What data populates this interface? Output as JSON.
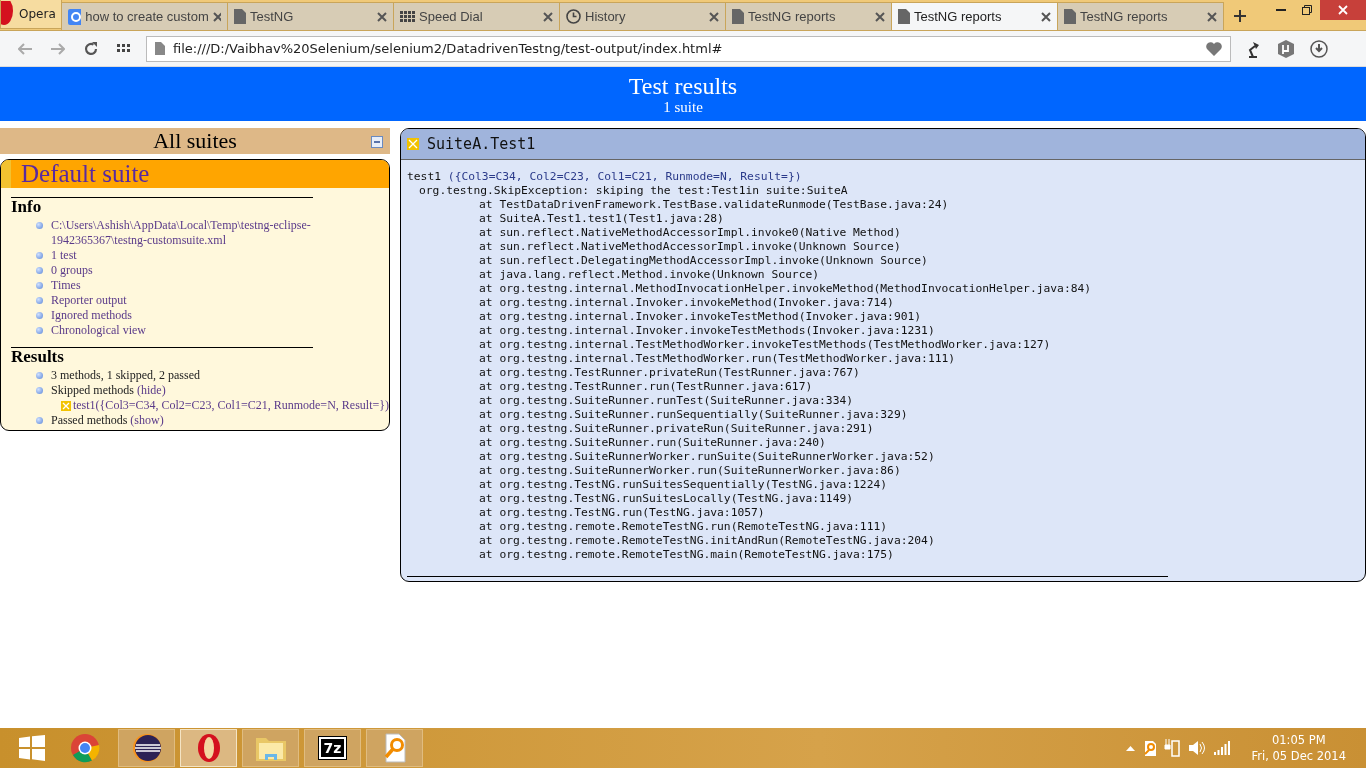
{
  "browser": {
    "menu_label": "Opera",
    "tabs": [
      {
        "kind": "google",
        "label": "how to create custom",
        "selected": false
      },
      {
        "kind": "page",
        "label": "TestNG",
        "selected": false
      },
      {
        "kind": "speeddial",
        "label": "Speed Dial",
        "selected": false
      },
      {
        "kind": "history",
        "label": "History",
        "selected": false
      },
      {
        "kind": "page",
        "label": "TestNG reports",
        "selected": false
      },
      {
        "kind": "page",
        "label": "TestNG reports",
        "selected": true
      },
      {
        "kind": "page",
        "label": "TestNG reports",
        "selected": false
      }
    ],
    "address": "file:///D:/Vaibhav%20Selenium/selenium2/DatadrivenTestng/test-output/index.html#"
  },
  "header": {
    "title": "Test results",
    "subtitle": "1 suite"
  },
  "sidebar": {
    "title": "All suites",
    "suite": {
      "name": "Default suite",
      "sections": [
        {
          "title": "Info",
          "items": [
            {
              "kind": "link",
              "text": "C:\\Users\\Ashish\\AppData\\Local\\Temp\\testng-eclipse-1942365367\\testng-customsuite.xml"
            },
            {
              "kind": "link",
              "text": "1 test"
            },
            {
              "kind": "link",
              "text": "0 groups"
            },
            {
              "kind": "link",
              "text": "Times"
            },
            {
              "kind": "link",
              "text": "Reporter output"
            },
            {
              "kind": "link",
              "text": "Ignored methods"
            },
            {
              "kind": "link",
              "text": "Chronological view"
            }
          ]
        },
        {
          "title": "Results",
          "items": [
            {
              "kind": "text",
              "text": "3 methods, 1 skipped, 2 passed"
            },
            {
              "kind": "text",
              "text": "Skipped methods",
              "link": "(hide)",
              "children": [
                {
                  "kind": "skipped",
                  "text": "test1({Col3=C34, Col2=C23, Col1=C21, Runmode=N, Result=})"
                }
              ]
            },
            {
              "kind": "text",
              "text": "Passed methods",
              "link": "(show)"
            }
          ]
        }
      ]
    }
  },
  "detail": {
    "title": "SuiteA.Test1",
    "method": "test1",
    "params": "({Col3=C34, Col2=C23, Col1=C21, Runmode=N, Result=})",
    "trace": [
      {
        "kind": "exception",
        "text": "org.testng.SkipException: skiping the test:Test1in suite:SuiteA"
      },
      {
        "kind": "frame",
        "text": "at TestDataDrivenFramework.TestBase.validateRunmode(TestBase.java:24)"
      },
      {
        "kind": "frame",
        "text": "at SuiteA.Test1.test1(Test1.java:28)"
      },
      {
        "kind": "frame",
        "text": "at sun.reflect.NativeMethodAccessorImpl.invoke0(Native Method)"
      },
      {
        "kind": "frame",
        "text": "at sun.reflect.NativeMethodAccessorImpl.invoke(Unknown Source)"
      },
      {
        "kind": "frame",
        "text": "at sun.reflect.DelegatingMethodAccessorImpl.invoke(Unknown Source)"
      },
      {
        "kind": "frame",
        "text": "at java.lang.reflect.Method.invoke(Unknown Source)"
      },
      {
        "kind": "frame",
        "text": "at org.testng.internal.MethodInvocationHelper.invokeMethod(MethodInvocationHelper.java:84)"
      },
      {
        "kind": "frame",
        "text": "at org.testng.internal.Invoker.invokeMethod(Invoker.java:714)"
      },
      {
        "kind": "frame",
        "text": "at org.testng.internal.Invoker.invokeTestMethod(Invoker.java:901)"
      },
      {
        "kind": "frame",
        "text": "at org.testng.internal.Invoker.invokeTestMethods(Invoker.java:1231)"
      },
      {
        "kind": "frame",
        "text": "at org.testng.internal.TestMethodWorker.invokeTestMethods(TestMethodWorker.java:127)"
      },
      {
        "kind": "frame",
        "text": "at org.testng.internal.TestMethodWorker.run(TestMethodWorker.java:111)"
      },
      {
        "kind": "frame",
        "text": "at org.testng.TestRunner.privateRun(TestRunner.java:767)"
      },
      {
        "kind": "frame",
        "text": "at org.testng.TestRunner.run(TestRunner.java:617)"
      },
      {
        "kind": "frame",
        "text": "at org.testng.SuiteRunner.runTest(SuiteRunner.java:334)"
      },
      {
        "kind": "frame",
        "text": "at org.testng.SuiteRunner.runSequentially(SuiteRunner.java:329)"
      },
      {
        "kind": "frame",
        "text": "at org.testng.SuiteRunner.privateRun(SuiteRunner.java:291)"
      },
      {
        "kind": "frame",
        "text": "at org.testng.SuiteRunner.run(SuiteRunner.java:240)"
      },
      {
        "kind": "frame",
        "text": "at org.testng.SuiteRunnerWorker.runSuite(SuiteRunnerWorker.java:52)"
      },
      {
        "kind": "frame",
        "text": "at org.testng.SuiteRunnerWorker.run(SuiteRunnerWorker.java:86)"
      },
      {
        "kind": "frame",
        "text": "at org.testng.TestNG.runSuitesSequentially(TestNG.java:1224)"
      },
      {
        "kind": "frame",
        "text": "at org.testng.TestNG.runSuitesLocally(TestNG.java:1149)"
      },
      {
        "kind": "frame",
        "text": "at org.testng.TestNG.run(TestNG.java:1057)"
      },
      {
        "kind": "frame",
        "text": "at org.testng.remote.RemoteTestNG.run(RemoteTestNG.java:111)"
      },
      {
        "kind": "frame",
        "text": "at org.testng.remote.RemoteTestNG.initAndRun(RemoteTestNG.java:204)"
      },
      {
        "kind": "frame",
        "text": "at org.testng.remote.RemoteTestNG.main(RemoteTestNG.java:175)"
      }
    ]
  },
  "taskbar": {
    "apps": [
      {
        "kind": "chrome",
        "running": false,
        "selected": false
      },
      {
        "kind": "eclipse",
        "running": true,
        "selected": false
      },
      {
        "kind": "opera",
        "running": true,
        "selected": true
      },
      {
        "kind": "explorer",
        "running": true,
        "selected": false
      },
      {
        "kind": "sevenzip",
        "label": "7z",
        "running": true,
        "selected": false
      },
      {
        "kind": "finder",
        "running": true,
        "selected": false
      }
    ],
    "time": "01:05 PM",
    "date": "Fri, 05 Dec 2014"
  }
}
